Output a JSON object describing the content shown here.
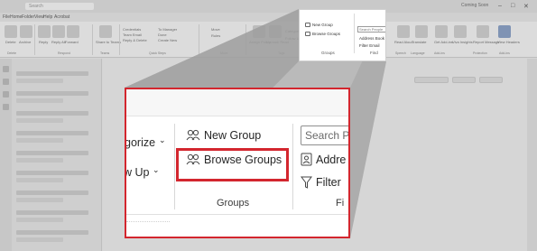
{
  "background_app": {
    "search_placeholder": "Search",
    "menu_tabs": [
      "File",
      "Home",
      "Folder",
      "View",
      "Help",
      "Acrobat"
    ],
    "coming_soon": "Coming Soon",
    "ribbon_labels": [
      "Delete",
      "Archive",
      "Reply",
      "Reply All",
      "Forward",
      "Share to Teams",
      "Move",
      "Rules",
      "Assign Policy",
      "Unread/ Read",
      "Categorize",
      "Follow Up",
      "Read Aloud",
      "Translate",
      "Get Add-ins",
      "Viva Insights",
      "Report Message",
      "View Headers"
    ],
    "ribbon_groups": [
      "Delete",
      "Respond",
      "Teams",
      "Quick Steps",
      "Move",
      "Tags",
      "Groups",
      "Find",
      "Speech",
      "Language",
      "Add-ins",
      "Protection",
      "Add-ins"
    ],
    "quick_steps": [
      "Credentials",
      "Team Email",
      "Reply & Delete",
      "To Manager",
      "Done",
      "Create New"
    ]
  },
  "source_region": {
    "new_group": "New Group",
    "browse_groups": "Browse Groups",
    "groups_label": "Groups",
    "search_people": "Search People",
    "address_book": "Address Book",
    "filter_email": "Filter Email",
    "find_label": "Find"
  },
  "zoom_panel": {
    "categorize_fragment": "gorize",
    "followup_fragment": "w Up",
    "new_group": "New Group",
    "browse_groups": "Browse Groups",
    "groups_label": "Groups",
    "search_people_fragment": "Search Pe",
    "address_fragment": "Addre",
    "filter_fragment": "Filter",
    "find_fragment": "Fi"
  },
  "colors": {
    "highlight_red": "#d3262e",
    "dim_gray": "#d4d4d4",
    "beam_gray": "#a8a8a8"
  }
}
